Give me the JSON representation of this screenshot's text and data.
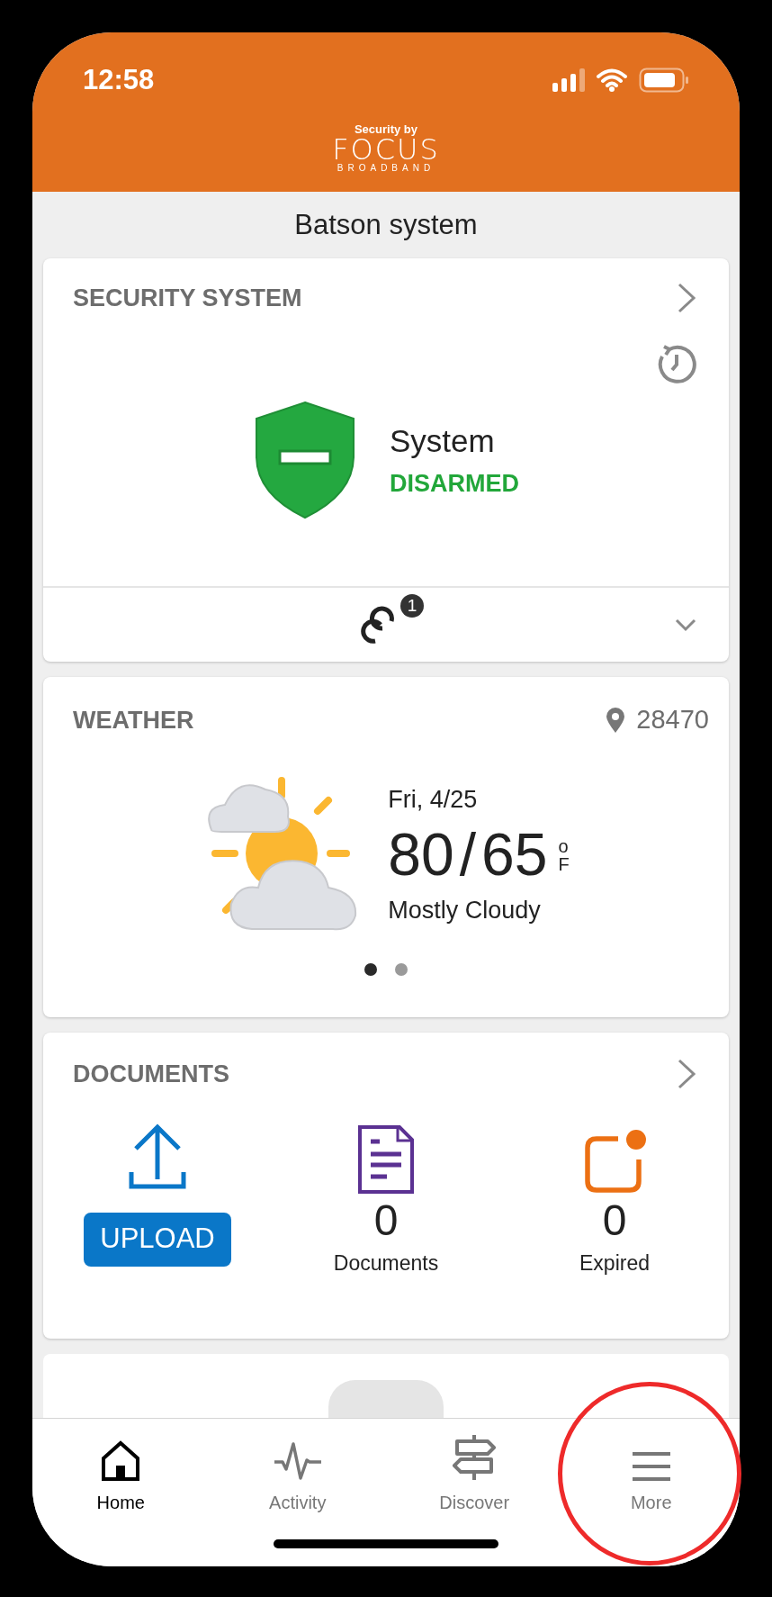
{
  "status_bar": {
    "time": "12:58"
  },
  "header": {
    "logo": {
      "tagline": "Security by",
      "brand": "FOCUS",
      "sub": "BROADBAND"
    }
  },
  "page_title": "Batson system",
  "security": {
    "title": "SECURITY SYSTEM",
    "label": "System",
    "status": "DISARMED",
    "armed": false,
    "devices_badge": "1",
    "expanded": false
  },
  "weather": {
    "title": "WEATHER",
    "location": "28470",
    "date": "Fri, 4/25",
    "high": "80",
    "separator": "/",
    "low": "65",
    "unit_degree": "o",
    "unit": "F",
    "condition": "Mostly Cloudy",
    "pages": [
      {
        "selected": true
      },
      {
        "selected": false
      }
    ]
  },
  "documents": {
    "title": "DOCUMENTS",
    "upload_button": "UPLOAD",
    "stats": [
      {
        "kind": "documents",
        "count": "0",
        "label": "Documents"
      },
      {
        "kind": "expired",
        "count": "0",
        "label": "Expired"
      }
    ]
  },
  "tab_bar": [
    {
      "kind": "home",
      "label": "Home",
      "selected": true
    },
    {
      "kind": "activity",
      "label": "Activity",
      "selected": false
    },
    {
      "kind": "discover",
      "label": "Discover",
      "selected": false
    },
    {
      "kind": "more",
      "label": "More",
      "selected": false
    }
  ],
  "annotation": {
    "kind": "circle",
    "color": "#ee2a2a"
  }
}
